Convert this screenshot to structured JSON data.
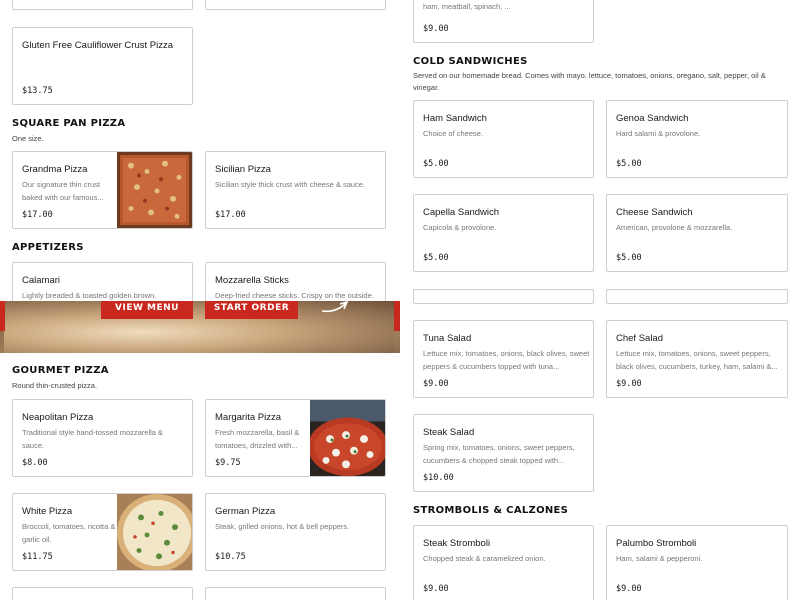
{
  "left": {
    "gluten_free": {
      "title": "Gluten Free Cauliflower Crust Pizza",
      "price": "$13.75"
    },
    "square_pan": {
      "heading": "SQUARE PAN PIZZA",
      "subtitle": "One size.",
      "items": [
        {
          "title": "Grandma Pizza",
          "desc": "Our signature thin crust baked with our famous...",
          "price": "$17.00"
        },
        {
          "title": "Sicilian Pizza",
          "desc": "Sicilian style thick crust with cheese & sauce.",
          "price": "$17.00"
        }
      ]
    },
    "appetizers": {
      "heading": "APPETIZERS",
      "items": [
        {
          "title": "Calamari",
          "desc": "Lightly breaded & toasted golden brown."
        },
        {
          "title": "Mozzarella Sticks",
          "desc": "Deep-fried cheese sticks. Crispy on the outside."
        }
      ]
    },
    "banner": {
      "view_menu": "VIEW MENU",
      "start_order": "START ORDER"
    },
    "gourmet": {
      "heading": "GOURMET PIZZA",
      "subtitle": "Round thin-crusted pizza.",
      "items": [
        {
          "title": "Neapolitan Pizza",
          "desc": "Traditional style hand-tossed mozzarella & sauce.",
          "price": "$8.00"
        },
        {
          "title": "Margarita Pizza",
          "desc": "Fresh mozzarella, basil & tomatoes, drizzled with...",
          "price": "$9.75"
        },
        {
          "title": "White Pizza",
          "desc": "Broccoli, tomatoes, ricotta & garlic oil.",
          "price": "$11.75"
        },
        {
          "title": "German Pizza",
          "desc": "Steak, grilled onions, hot & bell peppers.",
          "price": "$10.75"
        }
      ]
    }
  },
  "right": {
    "top_card": {
      "desc": "ham, meatball, spinach, ...",
      "price": "$9.00"
    },
    "cold_sandwiches": {
      "heading": "COLD SANDWICHES",
      "subtitle": "Served on our homemade bread. Comes with mayo. lettuce, tomatoes, onions, oregano, salt, pepper, oil & vinegar.",
      "items": [
        {
          "title": "Ham Sandwich",
          "desc": "Choice of cheese.",
          "price": "$5.00"
        },
        {
          "title": "Genoa Sandwich",
          "desc": "Hard salami & provolone.",
          "price": "$5.00"
        },
        {
          "title": "Capella Sandwich",
          "desc": "Capicola & provolone.",
          "price": "$5.00"
        },
        {
          "title": "Cheese Sandwich",
          "desc": "American, provolone & mozzarella.",
          "price": "$5.00"
        }
      ]
    },
    "salads": {
      "items": [
        {
          "title": "Tuna Salad",
          "desc": "Lettuce mix, tomatoes, onions, black olives, sweet peppers & cucumbers topped with tuna...",
          "price": "$9.00"
        },
        {
          "title": "Chef Salad",
          "desc": "Lettuce mix, tomatoes, onions, sweet peppers, black olives, cucumbers, turkey, ham, salami &...",
          "price": "$9.00"
        },
        {
          "title": "Steak Salad",
          "desc": "Spring mix, tomatoes, onions, sweet peppers, cucumbers & chopped steak topped with...",
          "price": "$10.00"
        }
      ]
    },
    "strombolis": {
      "heading": "STROMBOLIS & CALZONES",
      "items": [
        {
          "title": "Steak Stromboli",
          "desc": "Chopped steak & caramelized onion.",
          "price": "$9.00"
        },
        {
          "title": "Palumbo Stromboli",
          "desc": "Ham, salami & pepperoni.",
          "price": "$9.00"
        }
      ]
    }
  },
  "colors": {
    "accent_red": "#c8281e",
    "border": "#cfcfcf",
    "muted_text": "#777777"
  },
  "icons": {
    "banner_arrow": "arrow-icon"
  }
}
